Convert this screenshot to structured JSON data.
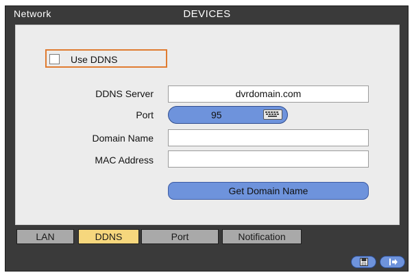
{
  "header": {
    "section": "Network",
    "title": "DEVICES"
  },
  "ddns": {
    "use_ddns_label": "Use DDNS",
    "use_ddns_checked": false,
    "server_label": "DDNS Server",
    "server_value": "dvrdomain.com",
    "port_label": "Port",
    "port_value": "95",
    "domain_label": "Domain Name",
    "domain_value": "",
    "mac_label": "MAC Address",
    "mac_value": "",
    "get_domain_button": "Get Domain Name"
  },
  "tabs": [
    {
      "label": "LAN",
      "active": false
    },
    {
      "label": "DDNS",
      "active": true
    },
    {
      "label": "Port",
      "active": false
    },
    {
      "label": "Notification",
      "active": false
    }
  ],
  "footer": {
    "save_icon": "save-icon",
    "exit_icon": "exit-icon"
  },
  "colors": {
    "window_bg": "#3a3a3a",
    "panel_bg": "#ececec",
    "accent_blue": "#6e93dc",
    "focus_orange": "#e07b2f",
    "active_tab": "#f6d77d",
    "inactive_tab": "#a9a9a9"
  }
}
